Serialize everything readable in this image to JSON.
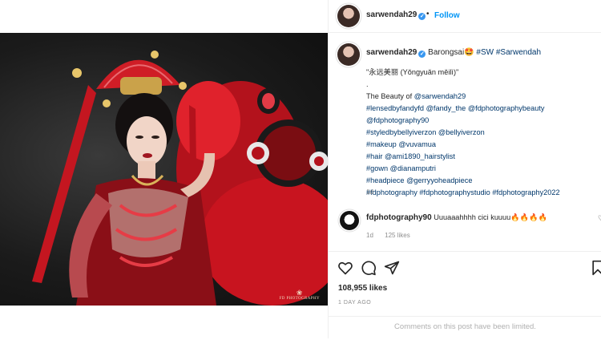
{
  "post": {
    "author": "sarwendah29",
    "header_dot": "•",
    "follow_label": "Follow",
    "verified_mark": "✓"
  },
  "caption": {
    "author": "sarwendah29",
    "title_text": "Barongsai🤩",
    "title_tags": "#SW #Sarwendah",
    "lines": [
      "\"永远美丽 (Yǒngyuǎn měilì)\"",
      ".",
      "The Beauty of @sarwendah29",
      "#lensedbyfandyfd @fandy_the @fdphotographybeauty",
      "@fdphotography90",
      "#styledbybellyiverzon @bellyiverzon",
      "#makeup @vuvamua",
      "#hair @ami1890_hairstylist",
      "#gown @dianamputri",
      "#headpiece @gerryyoheadpiece",
      "#fdphotography #fdphotographystudio #fdphotography2022"
    ],
    "line_prefix": "The Beauty of ",
    "line_mention": "@sarwendah29",
    "time": "1d"
  },
  "comment": {
    "author": "fdphotography90",
    "text": "Uuuaaahhhh cici kuuuu🔥🔥🔥🔥",
    "time": "1d",
    "likes": "125 likes"
  },
  "actions": {
    "like_icon": "heart-icon",
    "comment_icon": "comment-icon",
    "share_icon": "share-icon",
    "save_icon": "bookmark-icon"
  },
  "stats": {
    "likes": "108,955 likes",
    "ago": "1 DAY AGO"
  },
  "footer": {
    "limited": "Comments on this post have been limited."
  },
  "media": {
    "watermark": "FD PHOTOGRAPHY",
    "watermark_mark": "❀"
  },
  "colors": {
    "accent": "#0095f6",
    "verified": "#3897f0",
    "link": "#00376b",
    "muted": "#8e8e8e"
  }
}
